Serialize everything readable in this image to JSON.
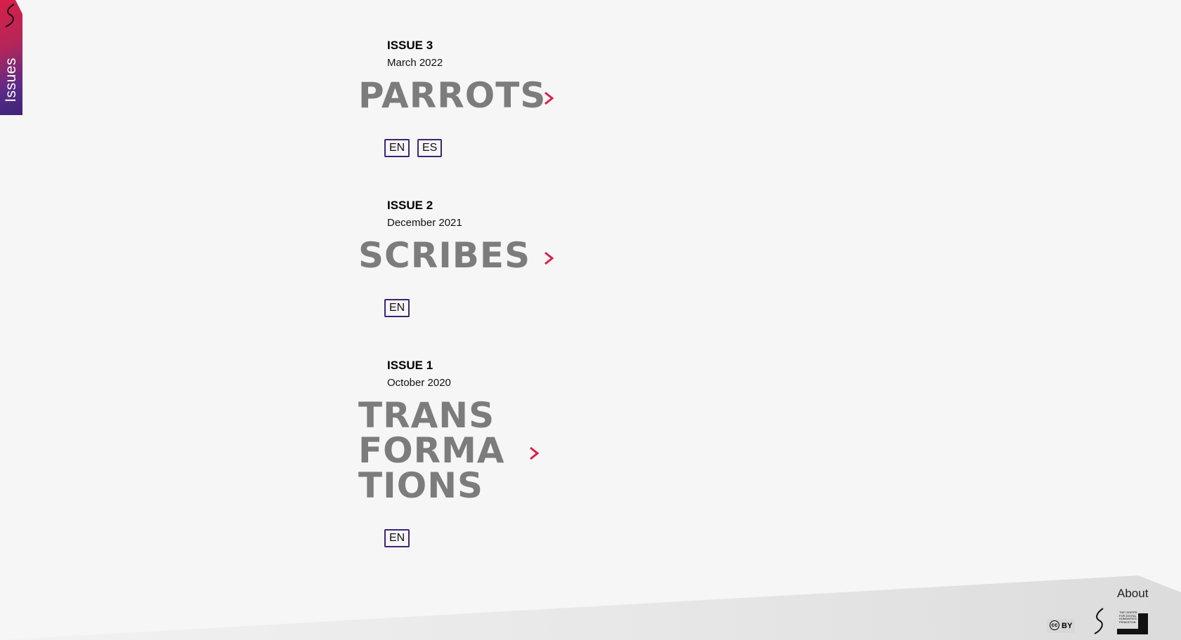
{
  "sidebar": {
    "label": "Issues"
  },
  "issues": [
    {
      "number": "ISSUE 3",
      "date": "March 2022",
      "title": "PARROTS",
      "languages": [
        "EN",
        "ES"
      ]
    },
    {
      "number": "ISSUE 2",
      "date": "December 2021",
      "title": "SCRIBES",
      "languages": [
        "EN"
      ]
    },
    {
      "number": "ISSUE 1",
      "date": "October 2020",
      "title": "TRANS\nFORMA\nTIONS",
      "languages": [
        "EN"
      ]
    }
  ],
  "footer": {
    "about_label": "About",
    "license": {
      "cc": "cc",
      "by": "BY"
    },
    "center_logo_text": "THE CENTER FOR DIGITAL HUMANITIES PRINCETON"
  },
  "colors": {
    "accent": "#d81f4a",
    "purple": "#3d2478",
    "title_gray": "#7c7c7c",
    "background": "#f6f6f6"
  },
  "icons": {
    "chevron": "chevron-right-icon",
    "logo": "s-logo-icon"
  }
}
